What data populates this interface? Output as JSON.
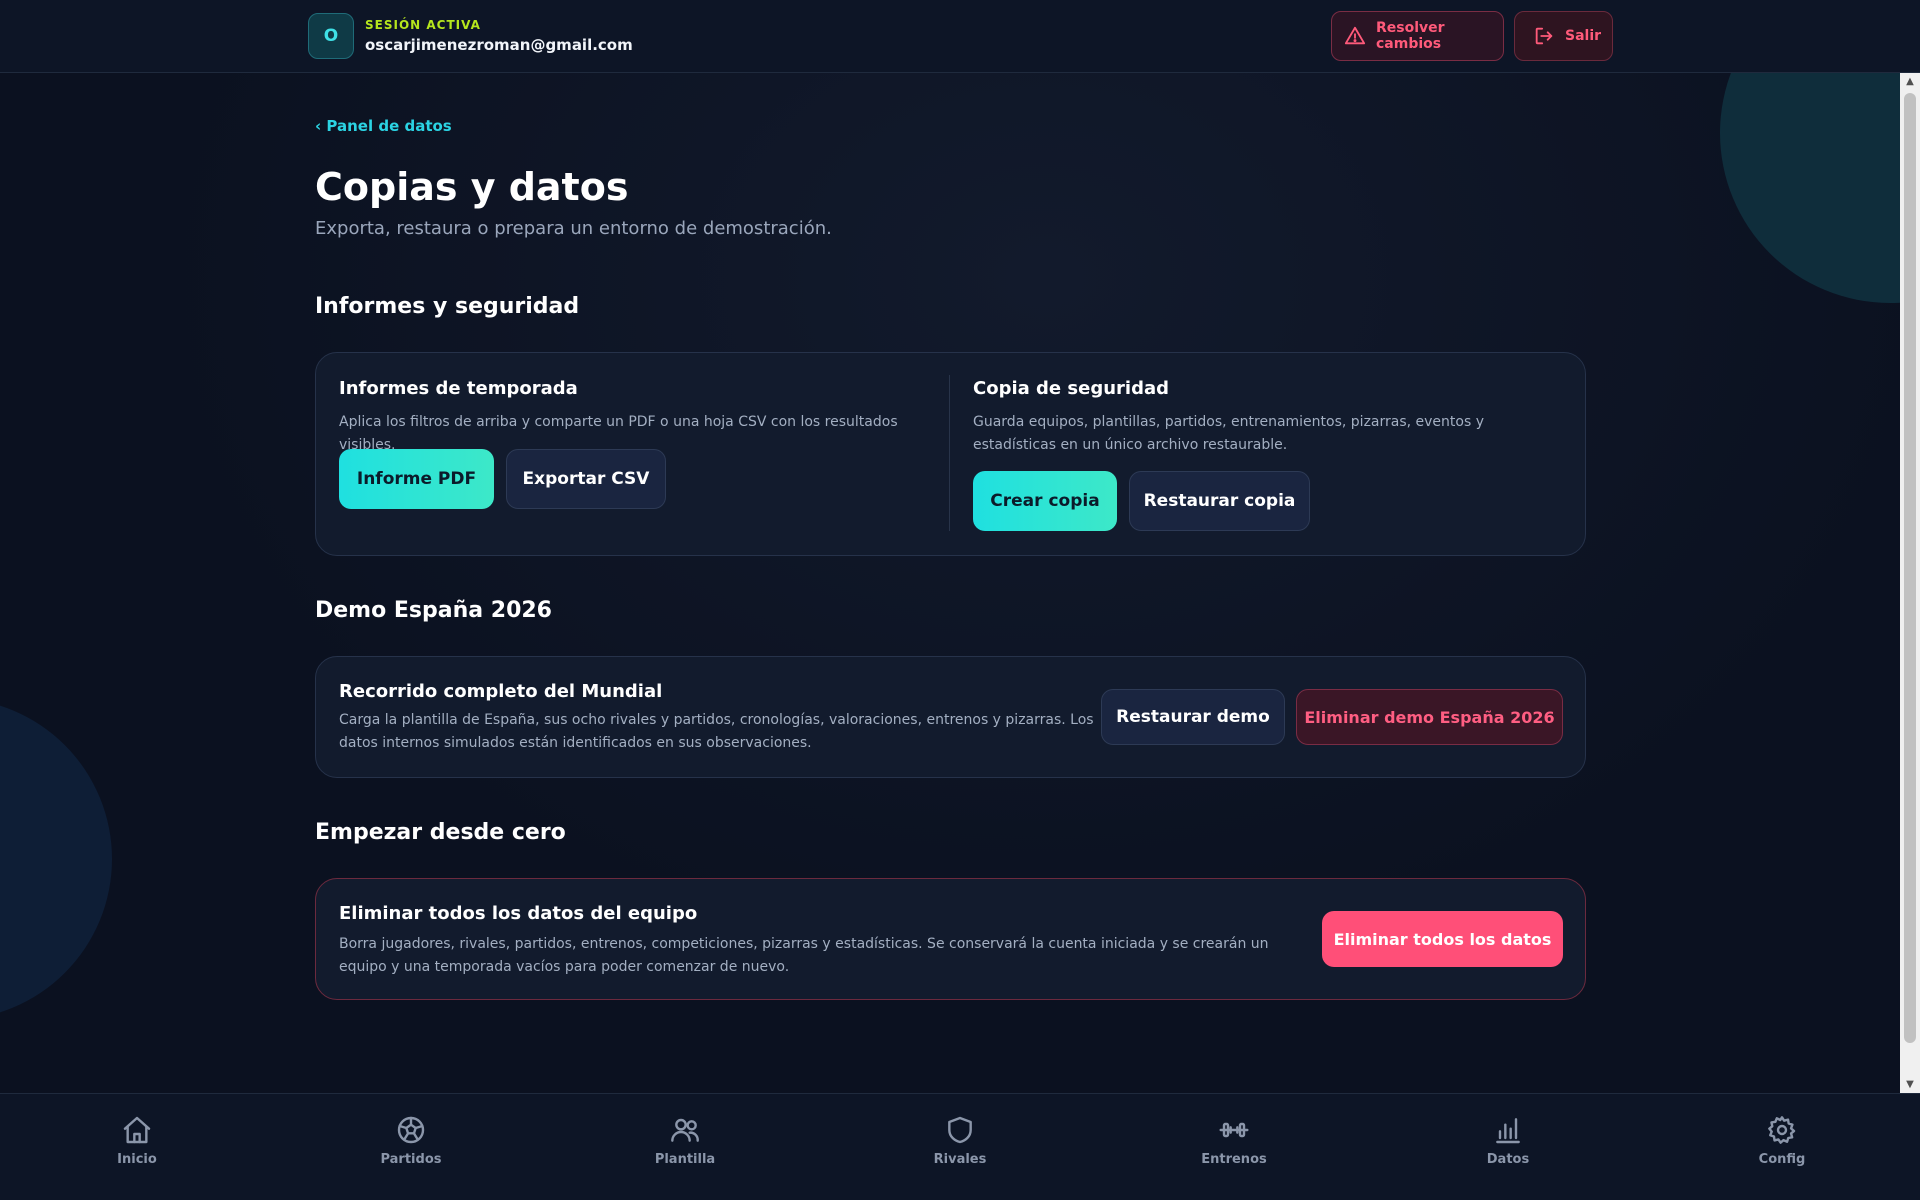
{
  "header": {
    "avatar_initial": "O",
    "session_label": "SESIÓN ACTIVA",
    "email": "oscarjimenezroman@gmail.com",
    "resolve_label": "Resolver cambios",
    "exit_label": "Salir"
  },
  "page": {
    "back_link": "‹ Panel de datos",
    "title": "Copias y datos",
    "subtitle": "Exporta, restaura o prepara un entorno de demostración."
  },
  "sections": {
    "reports": {
      "title": "Informes y seguridad",
      "season_reports": {
        "heading": "Informes de temporada",
        "description": "Aplica los filtros de arriba y comparte un PDF o una hoja CSV con los resultados visibles.",
        "pdf_label": "Informe PDF",
        "csv_label": "Exportar CSV"
      },
      "backup": {
        "heading": "Copia de seguridad",
        "description": "Guarda equipos, plantillas, partidos, entrenamientos, pizarras, eventos y estadísticas en un único archivo restaurable.",
        "create_label": "Crear copia",
        "restore_label": "Restaurar copia"
      }
    },
    "demo": {
      "title": "Demo España 2026",
      "heading": "Recorrido completo del Mundial",
      "description": "Carga la plantilla de España, sus ocho rivales y partidos, cronologías, valoraciones, entrenos y pizarras. Los datos internos simulados están identificados en sus observaciones.",
      "restore_label": "Restaurar demo",
      "delete_label": "Eliminar demo España 2026"
    },
    "reset": {
      "title": "Empezar desde cero",
      "heading": "Eliminar todos los datos del equipo",
      "description": "Borra jugadores, rivales, partidos, entrenos, competiciones, pizarras y estadísticas. Se conservará la cuenta iniciada y se crearán un equipo y una temporada vacíos para poder comenzar de nuevo.",
      "delete_all_label": "Eliminar todos los datos"
    }
  },
  "nav": {
    "items": [
      {
        "label": "Inicio",
        "icon": "home-icon"
      },
      {
        "label": "Partidos",
        "icon": "ball-icon"
      },
      {
        "label": "Plantilla",
        "icon": "users-icon"
      },
      {
        "label": "Rivales",
        "icon": "shield-icon"
      },
      {
        "label": "Entrenos",
        "icon": "dumbbell-icon"
      },
      {
        "label": "Datos",
        "icon": "bar-chart-icon"
      },
      {
        "label": "Config",
        "icon": "gear-icon"
      }
    ]
  },
  "colors": {
    "accent": "#2bd3e3",
    "danger": "#ff4f78",
    "session_label": "#b5e61d",
    "background": "#0b1120"
  }
}
